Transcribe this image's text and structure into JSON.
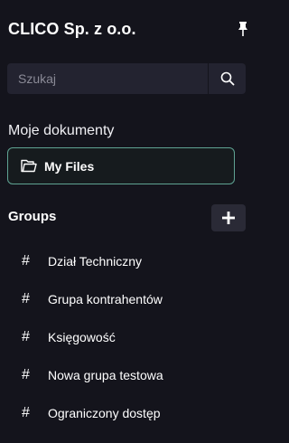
{
  "header": {
    "company_name": "CLICO Sp. z o.o.",
    "pin_icon": "pin-icon"
  },
  "search": {
    "placeholder": "Szukaj",
    "value": "",
    "icon": "search-icon"
  },
  "documents": {
    "section_label": "Moje dokumenty",
    "my_files_label": "My Files",
    "folder_icon": "folder-icon"
  },
  "groups": {
    "title": "Groups",
    "add_label": "+",
    "items": [
      {
        "hash": "#",
        "label": "Dział Techniczny"
      },
      {
        "hash": "#",
        "label": "Grupa kontrahentów"
      },
      {
        "hash": "#",
        "label": "Księgowość"
      },
      {
        "hash": "#",
        "label": "Nowa grupa testowa"
      },
      {
        "hash": "#",
        "label": "Ograniczony dostęp"
      }
    ]
  },
  "colors": {
    "background": "#14141c",
    "accent_border": "#5fa393",
    "input_bg": "#232330"
  }
}
